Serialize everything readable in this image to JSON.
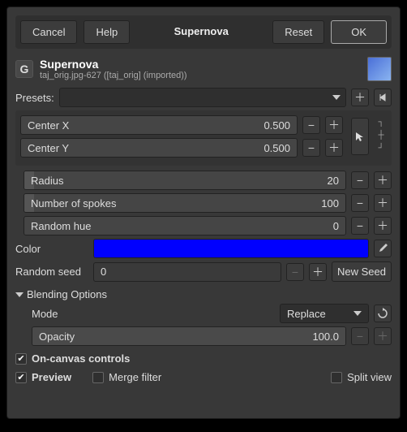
{
  "buttons": {
    "cancel": "Cancel",
    "help": "Help",
    "reset": "Reset",
    "ok": "OK"
  },
  "title": "Supernova",
  "header": {
    "title": "Supernova",
    "subtitle": "taj_orig.jpg-627 ([taj_orig] (imported))"
  },
  "presets_label": "Presets:",
  "centerx": {
    "label": "Center X",
    "value": "0.500"
  },
  "centery": {
    "label": "Center Y",
    "value": "0.500"
  },
  "radius": {
    "label": "Radius",
    "value": "20"
  },
  "spokes": {
    "label": "Number of spokes",
    "value": "100"
  },
  "randhue": {
    "label": "Random hue",
    "value": "0"
  },
  "color_label": "Color",
  "color_value": "#0000ff",
  "randseed": {
    "label": "Random seed",
    "value": "0",
    "newseed": "New Seed"
  },
  "blending": {
    "title": "Blending Options",
    "mode_label": "Mode",
    "mode_value": "Replace",
    "opacity_label": "Opacity",
    "opacity_value": "100.0"
  },
  "checks": {
    "oncanvas": "On-canvas controls",
    "preview": "Preview",
    "merge": "Merge filter",
    "split": "Split view"
  }
}
